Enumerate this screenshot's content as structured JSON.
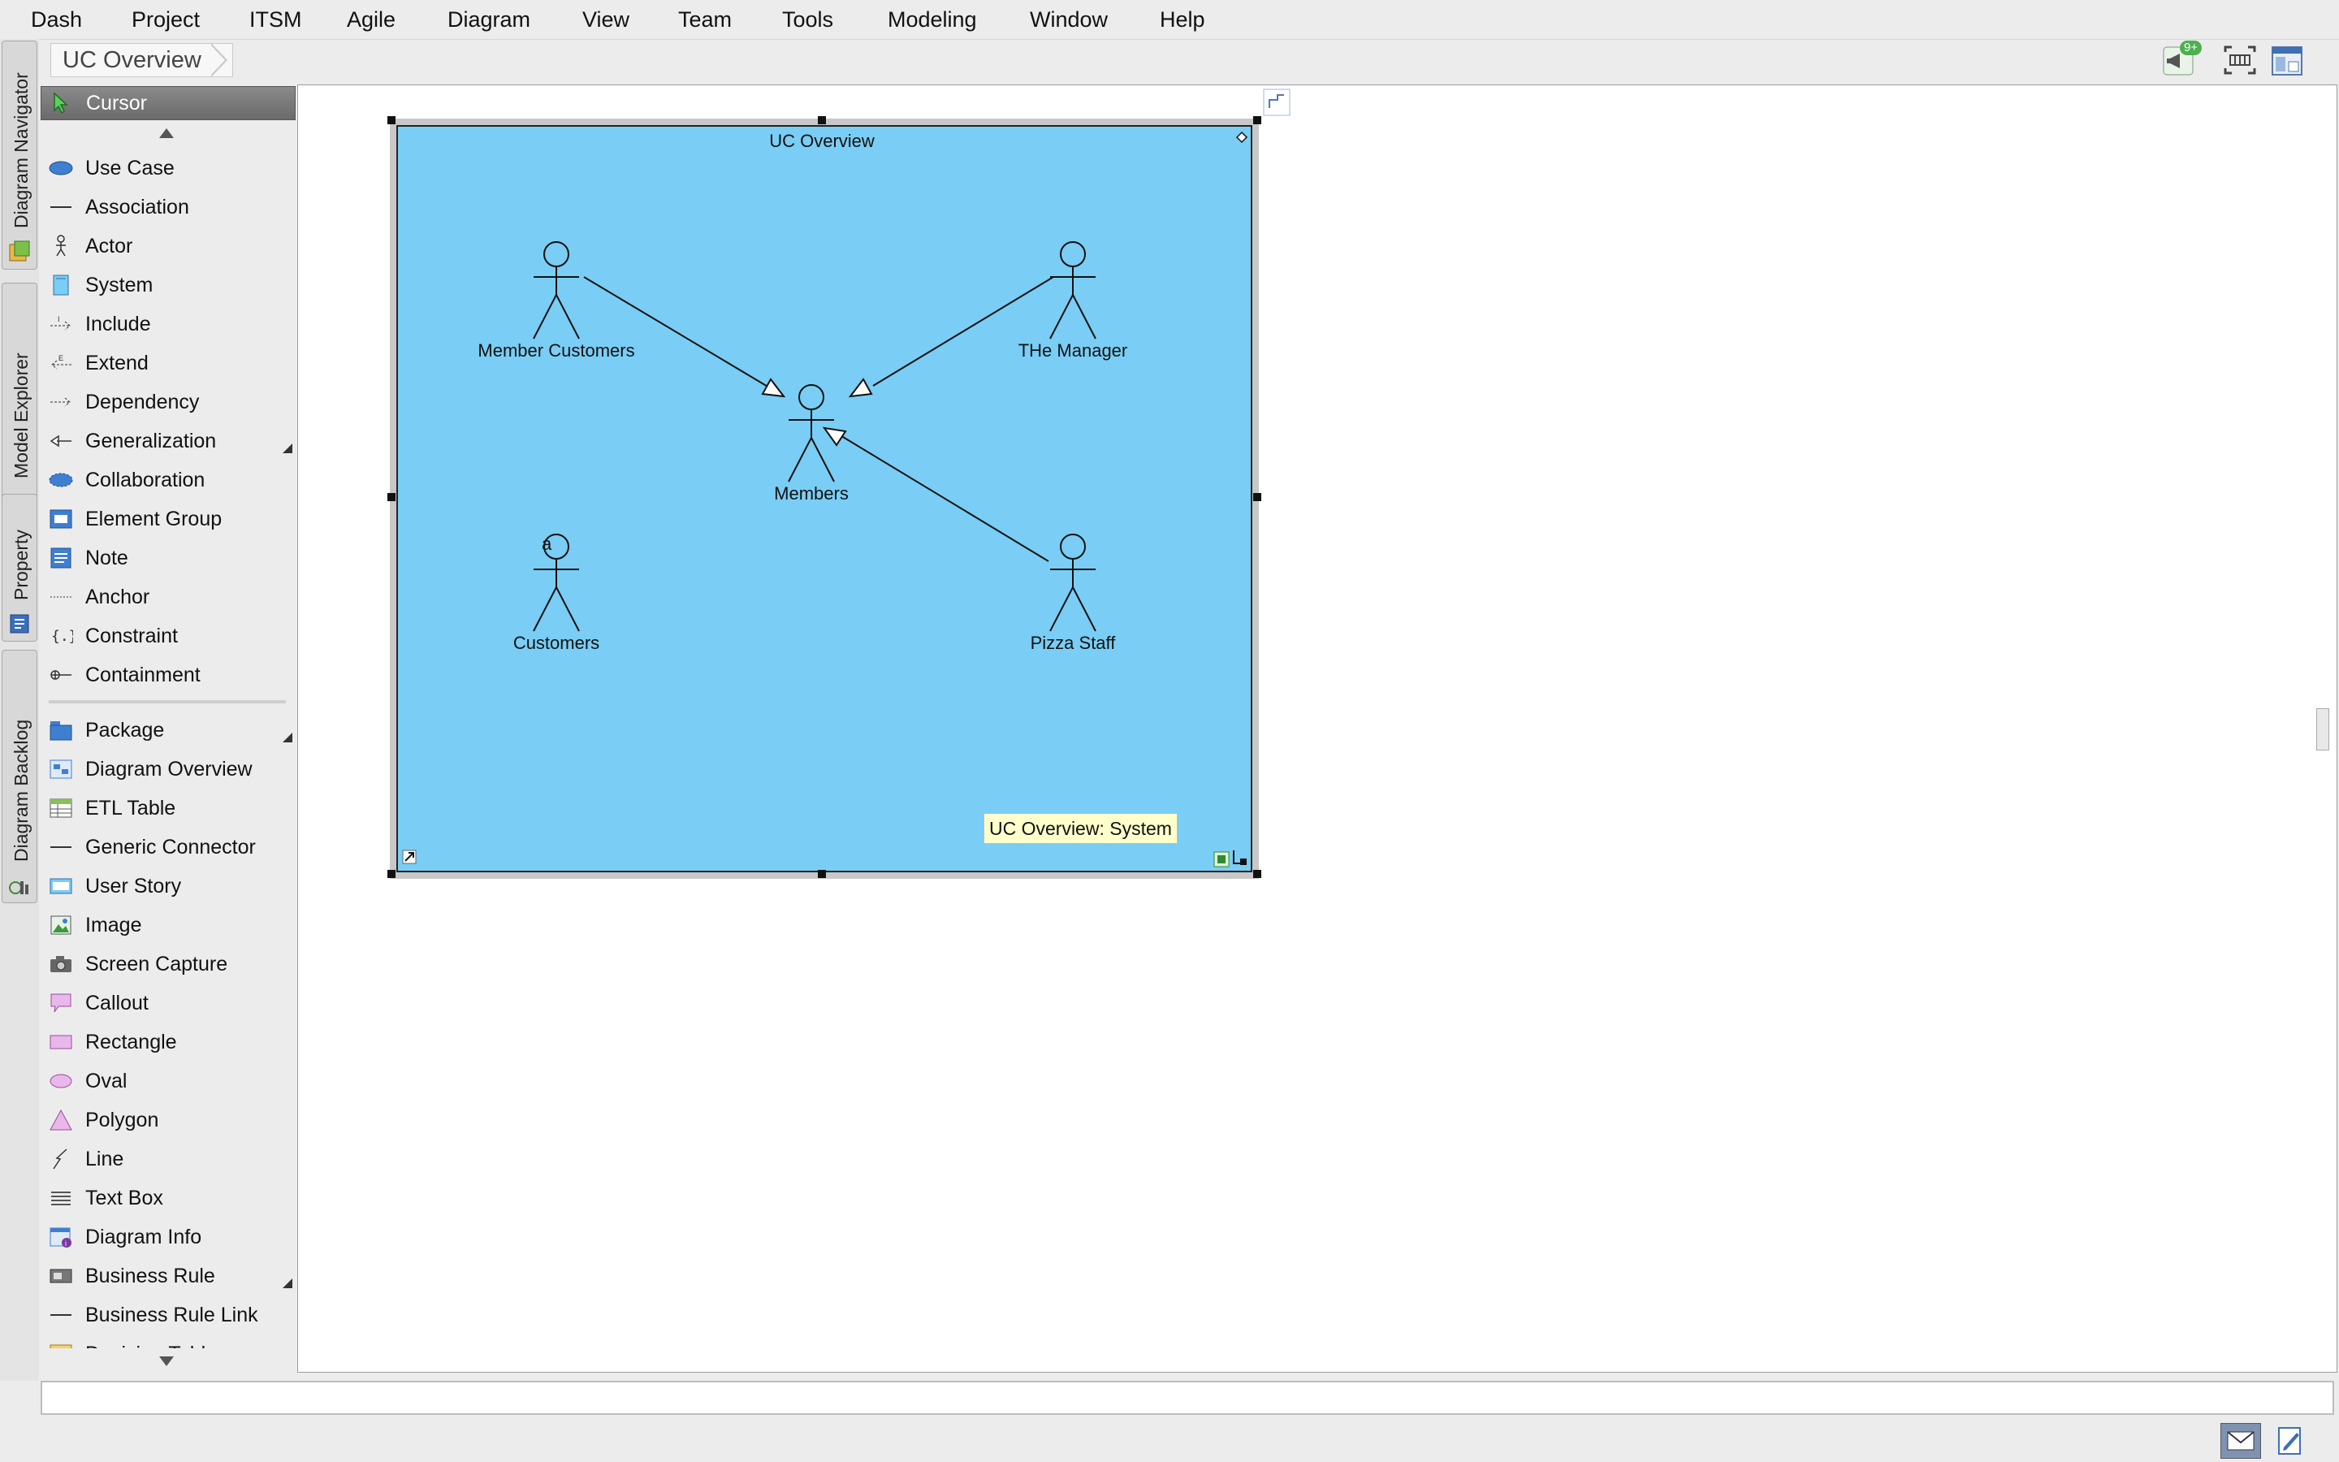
{
  "menu": [
    "Dash",
    "Project",
    "ITSM",
    "Agile",
    "Diagram",
    "View",
    "Team",
    "Tools",
    "Modeling",
    "Window",
    "Help"
  ],
  "breadcrumb": "UC Overview",
  "toolbar": {
    "notification_badge": "9+"
  },
  "side_tabs": [
    "Diagram Navigator",
    "Model Explorer",
    "Property",
    "Diagram Backlog"
  ],
  "palette": {
    "cursor": "Cursor",
    "items": [
      "Use Case",
      "Association",
      "Actor",
      "System",
      "Include",
      "Extend",
      "Dependency",
      "Generalization",
      "Collaboration",
      "Element Group",
      "Note",
      "Anchor",
      "Constraint",
      "Containment",
      "Package",
      "Diagram Overview",
      "ETL Table",
      "Generic Connector",
      "User Story",
      "Image",
      "Screen Capture",
      "Callout",
      "Rectangle",
      "Oval",
      "Polygon",
      "Line",
      "Text Box",
      "Diagram Info",
      "Business Rule",
      "Business Rule Link"
    ],
    "partial_item": "Decision Table"
  },
  "diagram": {
    "system_name": "UC Overview",
    "actors": [
      "Member Customers",
      "THe Manager",
      "Members",
      "Customers",
      "Pizza Staff"
    ],
    "customers_marker": "a",
    "tooltip": "UC Overview: System"
  },
  "colors": {
    "system_fill": "#7acdf4",
    "canvas": "#ffffff",
    "selection": "#222222"
  }
}
